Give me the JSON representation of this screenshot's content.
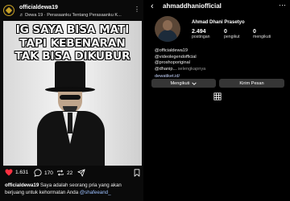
{
  "post": {
    "username": "officialdewa19",
    "song": "♬ Dewa 19 · Perasaanku Tentang Perasaanku K...",
    "image_text": [
      "IG SAYA BISA MATI",
      "TAPI KEBENARAN",
      "TAK BISA DIKUBUR"
    ],
    "likes": "1.631",
    "comments": "170",
    "reposts": "22",
    "caption_user": "officialdewa19",
    "caption_text": "Saya adalah seorang pria yang akan berjuang untuk kehormatan Anda",
    "caption_mention": "@shafeeand_"
  },
  "profile": {
    "handle": "ahmaddhaniofficial",
    "full_name": "Ahmad Dhani Prasetyo",
    "stats": [
      {
        "value": "2.494",
        "label": "postingan"
      },
      {
        "value": "0",
        "label": "pengikut"
      },
      {
        "value": "0",
        "label": "mengikuti"
      }
    ],
    "bio": {
      "line1": "@officialdewa19",
      "line2": "@videolegendofficial",
      "line3": "@proshoporiginal",
      "line4": "@dhanip...",
      "more": "selengkapnya"
    },
    "link": "dewatiket.id/",
    "follow_button": "Mengikuti",
    "message_button": "Kirim Pesan"
  },
  "colors": {
    "background": "#000000",
    "button": "#363636",
    "like": "#ff3040",
    "link": "#c7d6ff"
  }
}
